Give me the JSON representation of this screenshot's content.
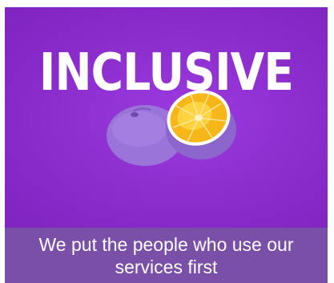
{
  "hero": {
    "title": "INCLUSIVE",
    "image": "purple-painted-orange-icon"
  },
  "caption": {
    "text": "We put the people who use our services first"
  },
  "colors": {
    "background": "#8f2fd2",
    "caption_bar": "#7a4fa8",
    "text": "#ffffff",
    "orange_flesh": "#f7b718"
  }
}
